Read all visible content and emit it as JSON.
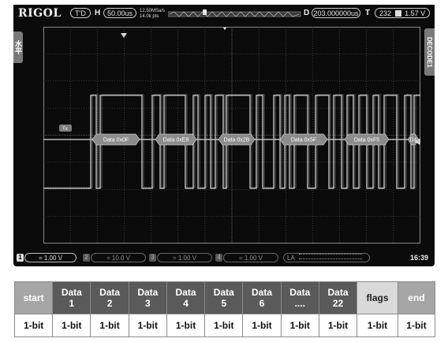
{
  "scope": {
    "brand": "RIGOL",
    "trigger_status": "T'D",
    "h_label": "H",
    "timebase": "50.00us",
    "sample_rate": "12.50MSa/s",
    "mem_depth": "14.0k pts",
    "delay_label": "D",
    "delay": "203.000000us",
    "trig_label": "T",
    "trig_source": "232",
    "trig_level": "1.57 V",
    "left_tab": "水平",
    "right_tab": "DECODE1",
    "decode_tag": "Tx",
    "packets": [
      "Data 0x0F",
      "Data 0xE8",
      "Data 0x2B",
      "Data 0x5F",
      "Data 0xF5",
      "D4"
    ],
    "channels": [
      {
        "num": "1",
        "coupling": "=",
        "scale": "1.00 V"
      },
      {
        "num": "2",
        "coupling": "=",
        "scale": "10.0 V"
      },
      {
        "num": "3",
        "coupling": "=",
        "scale": "1.00 V"
      },
      {
        "num": "4",
        "coupling": "=",
        "scale": "1.00 V"
      }
    ],
    "la_label": "LA",
    "time": "16:39"
  },
  "frame": {
    "headers": [
      {
        "l1": "start",
        "l2": "",
        "bg": "#a6a6a6"
      },
      {
        "l1": "Data",
        "l2": "1",
        "bg": "#5a5a5a"
      },
      {
        "l1": "Data",
        "l2": "2",
        "bg": "#5a5a5a"
      },
      {
        "l1": "Data",
        "l2": "3",
        "bg": "#5a5a5a"
      },
      {
        "l1": "Data",
        "l2": "4",
        "bg": "#5a5a5a"
      },
      {
        "l1": "Data",
        "l2": "5",
        "bg": "#5a5a5a"
      },
      {
        "l1": "Data",
        "l2": "6",
        "bg": "#5a5a5a"
      },
      {
        "l1": "Data",
        "l2": "....",
        "bg": "#5a5a5a"
      },
      {
        "l1": "Data",
        "l2": "22",
        "bg": "#5a5a5a"
      },
      {
        "l1": "flags",
        "l2": "",
        "bg": "#d9d9d9"
      },
      {
        "l1": "end",
        "l2": "",
        "bg": "#a6a6a6"
      }
    ],
    "cells": [
      "1-bit",
      "1-bit",
      "1-bit",
      "1-bit",
      "1-bit",
      "1-bit",
      "1-bit",
      "1-bit",
      "1-bit",
      "1-bit",
      "1-bit"
    ]
  }
}
